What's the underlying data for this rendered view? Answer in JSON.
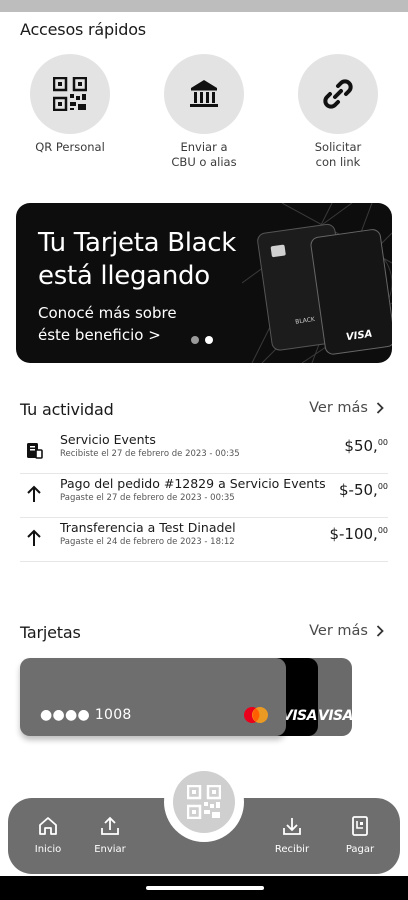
{
  "quick_access": {
    "title": "Accesos rápidos",
    "items": [
      {
        "label": "QR Personal",
        "icon": "qr-code-icon"
      },
      {
        "label": "Enviar a\nCBU o alias",
        "icon": "bank-icon"
      },
      {
        "label": "Solicitar\ncon link",
        "icon": "link-icon"
      }
    ]
  },
  "banner": {
    "title_line1": "Tu Tarjeta Black",
    "title_line2": "está llegando",
    "sub_line1": "Conocé más sobre",
    "sub_line2": "éste beneficio >",
    "card_brand": "VISA",
    "card_label": "BLACK"
  },
  "activity": {
    "title": "Tu actividad",
    "see_more": "Ver más",
    "items": [
      {
        "title": "Servicio Events",
        "subtitle": "Recibiste el 27 de febrero de 2023 - 00:35",
        "amount": "$50,",
        "cents": "00",
        "icon": "receipt-icon"
      },
      {
        "title": "Pago del pedido #12829 a Servicio Events",
        "subtitle": "Pagaste el 27 de febrero de 2023 - 00:35",
        "amount": "$-50,",
        "cents": "00",
        "icon": "arrow-up-icon"
      },
      {
        "title": "Transferencia a Test Dinadel",
        "subtitle": "Pagaste el 24 de febrero de 2023 - 18:12",
        "amount": "$-100,",
        "cents": "00",
        "icon": "arrow-up-icon"
      }
    ]
  },
  "cards": {
    "title": "Tarjetas",
    "see_more": "Ver más",
    "front_number": "●●●● 1008",
    "back_brand_1": "VISA",
    "back_brand_2": "VISA"
  },
  "nav": {
    "items": [
      {
        "label": "Inicio",
        "icon": "home-icon"
      },
      {
        "label": "Enviar",
        "icon": "send-icon"
      },
      {
        "label": "Recibir",
        "icon": "receive-icon"
      },
      {
        "label": "Pagar",
        "icon": "pay-icon"
      }
    ]
  }
}
